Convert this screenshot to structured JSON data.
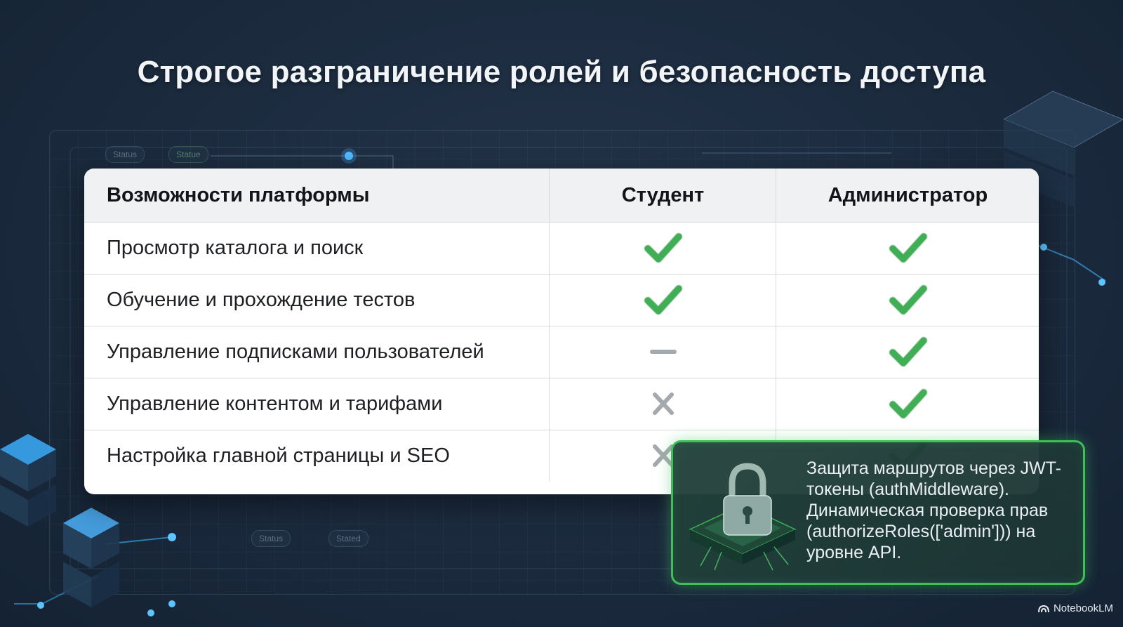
{
  "slide": {
    "title": "Строгое разграничение ролей и безопасность доступа"
  },
  "background_chips": [
    "Status",
    "Statue",
    "Status",
    "Stated"
  ],
  "table": {
    "headers": [
      "Возможности платформы",
      "Студент",
      "Администратор"
    ],
    "rows": [
      {
        "feature": "Просмотр каталога и поиск",
        "student": "check",
        "admin": "check"
      },
      {
        "feature": "Обучение и прохождение тестов",
        "student": "check",
        "admin": "check"
      },
      {
        "feature": "Управление подписками пользователей",
        "student": "dash",
        "admin": "check"
      },
      {
        "feature": "Управление контентом и тарифами",
        "student": "cross",
        "admin": "check"
      },
      {
        "feature": "Настройка главной страницы и SEO",
        "student": "cross",
        "admin": "check"
      }
    ]
  },
  "callout": {
    "text": "Защита маршрутов через JWT-токены (authMiddleware). Динамическая проверка прав (authorizeRoles(['admin'])) на уровне API.",
    "icon": "padlock-icon"
  },
  "brand": {
    "label": "NotebookLM"
  },
  "colors": {
    "check": "#3fae54",
    "cross": "#a4a9ae",
    "dash": "#a4a9ae",
    "callout_border": "#3fbe5a"
  }
}
